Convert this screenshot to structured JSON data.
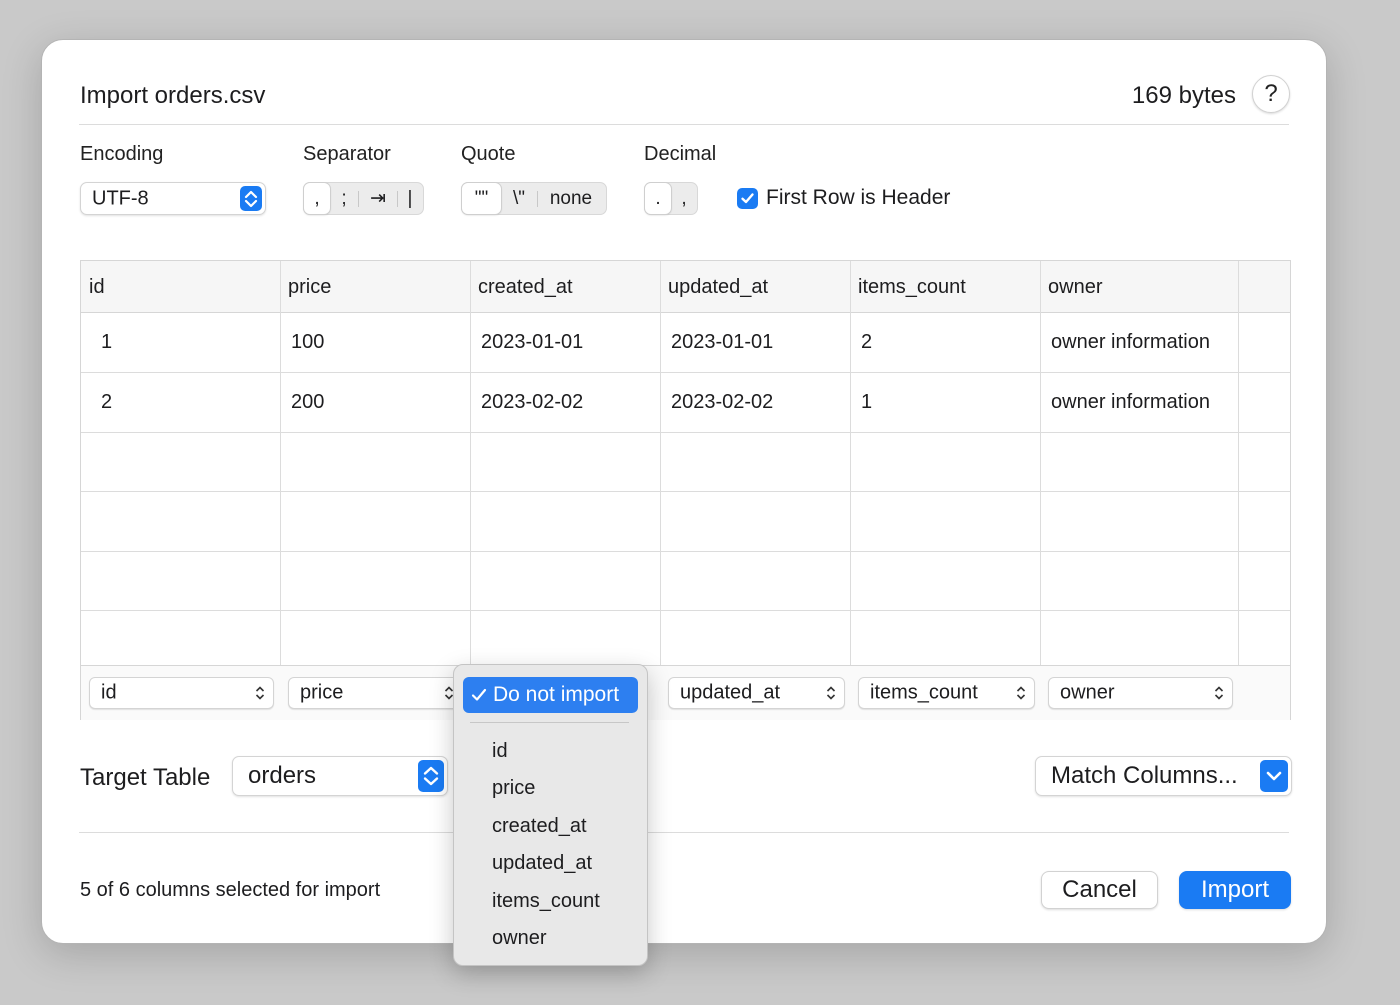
{
  "dialog": {
    "title": "Import orders.csv",
    "file_size": "169 bytes",
    "help_label": "?"
  },
  "options": {
    "encoding_label": "Encoding",
    "encoding_value": "UTF-8",
    "separator_label": "Separator",
    "separator_segments": [
      ",",
      ";",
      "⇥",
      "|"
    ],
    "separator_selected": ",",
    "quote_label": "Quote",
    "quote_segments": [
      "\"\"",
      "\\\"",
      "none"
    ],
    "quote_selected": "\"\"",
    "decimal_label": "Decimal",
    "decimal_segments": [
      ".",
      ","
    ],
    "decimal_selected": ".",
    "first_row_header_label": "First Row is Header",
    "first_row_header_checked": true
  },
  "table": {
    "headers": [
      "id",
      "price",
      "created_at",
      "updated_at",
      "items_count",
      "owner"
    ],
    "rows": [
      [
        "1",
        "100",
        "2023-01-01",
        "2023-01-01",
        "2",
        "owner information"
      ],
      [
        "2",
        "200",
        "2023-02-02",
        "2023-02-02",
        "1",
        "owner information"
      ]
    ],
    "mapping": [
      "id",
      "price",
      "Do not import",
      "updated_at",
      "items_count",
      "owner"
    ]
  },
  "target": {
    "label": "Target Table",
    "value": "orders",
    "match_columns_label": "Match Columns..."
  },
  "footer": {
    "status": "5 of 6 columns selected for import",
    "cancel_label": "Cancel",
    "import_label": "Import"
  },
  "column_menu": {
    "selected": "Do not import",
    "items": [
      "id",
      "price",
      "created_at",
      "updated_at",
      "items_count",
      "owner"
    ]
  },
  "colors": {
    "accent": "#1a7bf3",
    "background": "#c9c9c9"
  }
}
